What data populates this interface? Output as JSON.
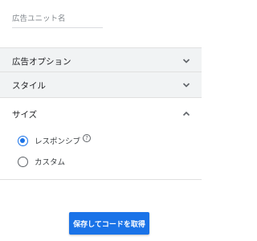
{
  "ad_unit_name": {
    "placeholder": "広告ユニット名",
    "value": ""
  },
  "sections": {
    "ad_options": {
      "label": "広告オプション",
      "icon": "chevron-down-icon"
    },
    "style": {
      "label": "スタイル",
      "icon": "chevron-down-icon"
    },
    "size": {
      "label": "サイズ",
      "icon": "chevron-up-icon",
      "options": [
        {
          "label": "レスポンシブ",
          "selected": true,
          "help_icon": "?"
        },
        {
          "label": "カスタム",
          "selected": false
        }
      ]
    }
  },
  "save_button": {
    "label": "保存してコードを取得"
  },
  "colors": {
    "accent": "#1a73e8",
    "section_bg": "#f1f3f4",
    "text": "#202124"
  }
}
